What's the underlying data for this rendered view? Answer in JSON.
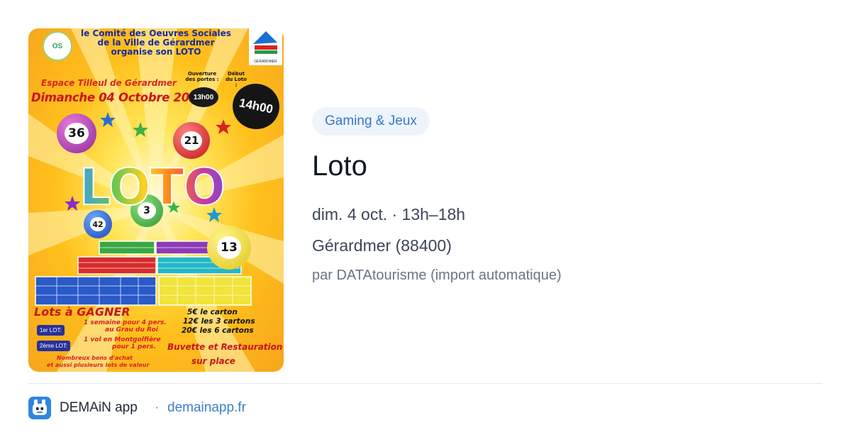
{
  "poster": {
    "header_lines": [
      "le Comité des Oeuvres Sociales",
      "de la Ville de Gérardmer",
      "organise son LOTO"
    ],
    "logo_left": "OS",
    "logo_right_caption": "GÉRARDMER",
    "venue": "Espace Tilleul de Gérardmer",
    "date": "Dimanche 04 Octobre 2026",
    "doors_label": "Ouverture des portes :",
    "doors_time": "13h00",
    "start_label": "Début du Loto :",
    "start_time": "14h00",
    "word": "LOTO",
    "balls": [
      "36",
      "21",
      "3",
      "42",
      "13"
    ],
    "lots_heading": "Lots à GAGNER",
    "lot1_label": "1er LOT:",
    "lot1_text_a": "1 semaine pour 4 pers.",
    "lot1_text_b": "au Grau du Roi",
    "lot2_label": "2ème LOT:",
    "lot2_text_a": "1 vol en Montgolfière",
    "lot2_text_b": "pour 1 pers.",
    "extras_a": "Nombreux bons d'achat",
    "extras_b": "et aussi plusieurs lots de valeur",
    "price_1": "5€ le carton",
    "price_2": "12€ les 3 cartons",
    "price_3": "20€ les 6 cartons",
    "buvette_a": "Buvette et Restauration",
    "buvette_b": "sur place"
  },
  "event": {
    "category": "Gaming & Jeux",
    "title": "Loto",
    "when": "dim. 4 oct. · 13h–18h",
    "where": "Gérardmer (88400)",
    "by": "par DATAtourisme (import automatique)"
  },
  "footer": {
    "app_name": "DEMAiN app",
    "separator": "·",
    "link": "demainapp.fr",
    "icon": "demain-app-icon"
  },
  "colors": {
    "chip_bg": "#eef4fb",
    "chip_text": "#3978c4",
    "link": "#3a7ecb",
    "app_icon": "#2f86de"
  }
}
